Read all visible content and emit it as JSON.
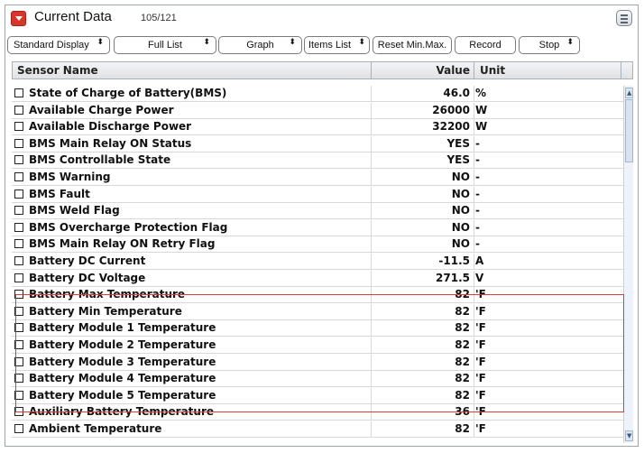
{
  "window": {
    "title": "Current Data",
    "count": "105/121"
  },
  "toolbar": {
    "buttons": [
      {
        "label": "Standard Display",
        "caret": "⬍"
      },
      {
        "label": "Full List",
        "caret": "⬍"
      },
      {
        "label": "Graph",
        "caret": "⬍"
      },
      {
        "label": "Items List",
        "caret": "⬍"
      },
      {
        "label": "Reset Min.Max.",
        "caret": ""
      },
      {
        "label": "Record",
        "caret": ""
      },
      {
        "label": "Stop",
        "caret": "⬍"
      }
    ]
  },
  "table": {
    "headers": {
      "name": "Sensor Name",
      "value": "Value",
      "unit": "Unit"
    },
    "rows": [
      {
        "name": "State of Charge of Battery(BMS)",
        "value": "46.0",
        "unit": "%"
      },
      {
        "name": "Available Charge Power",
        "value": "26000",
        "unit": "W"
      },
      {
        "name": "Available Discharge Power",
        "value": "32200",
        "unit": "W"
      },
      {
        "name": "BMS Main Relay ON Status",
        "value": "YES",
        "unit": "-"
      },
      {
        "name": "BMS Controllable State",
        "value": "YES",
        "unit": "-"
      },
      {
        "name": "BMS Warning",
        "value": "NO",
        "unit": "-"
      },
      {
        "name": "BMS Fault",
        "value": "NO",
        "unit": "-"
      },
      {
        "name": "BMS Weld Flag",
        "value": "NO",
        "unit": "-"
      },
      {
        "name": "BMS Overcharge Protection Flag",
        "value": "NO",
        "unit": "-"
      },
      {
        "name": "BMS Main Relay ON Retry Flag",
        "value": "NO",
        "unit": "-"
      },
      {
        "name": "Battery DC Current",
        "value": "-11.5",
        "unit": "A"
      },
      {
        "name": "Battery DC Voltage",
        "value": "271.5",
        "unit": "V"
      },
      {
        "name": "Battery Max Temperature",
        "value": "82",
        "unit": "'F"
      },
      {
        "name": "Battery Min Temperature",
        "value": "82",
        "unit": "'F"
      },
      {
        "name": "Battery Module 1 Temperature",
        "value": "82",
        "unit": "'F"
      },
      {
        "name": "Battery Module 2 Temperature",
        "value": "82",
        "unit": "'F"
      },
      {
        "name": "Battery Module 3 Temperature",
        "value": "82",
        "unit": "'F"
      },
      {
        "name": "Battery Module 4 Temperature",
        "value": "82",
        "unit": "'F"
      },
      {
        "name": "Battery Module 5 Temperature",
        "value": "82",
        "unit": "'F"
      },
      {
        "name": "Auxiliary Battery Temperature",
        "value": "36",
        "unit": "'F"
      },
      {
        "name": "Ambient Temperature",
        "value": "82",
        "unit": "'F"
      }
    ]
  },
  "colors": {
    "title_button": "#d9362b",
    "highlight_border": "#e03a3a"
  }
}
